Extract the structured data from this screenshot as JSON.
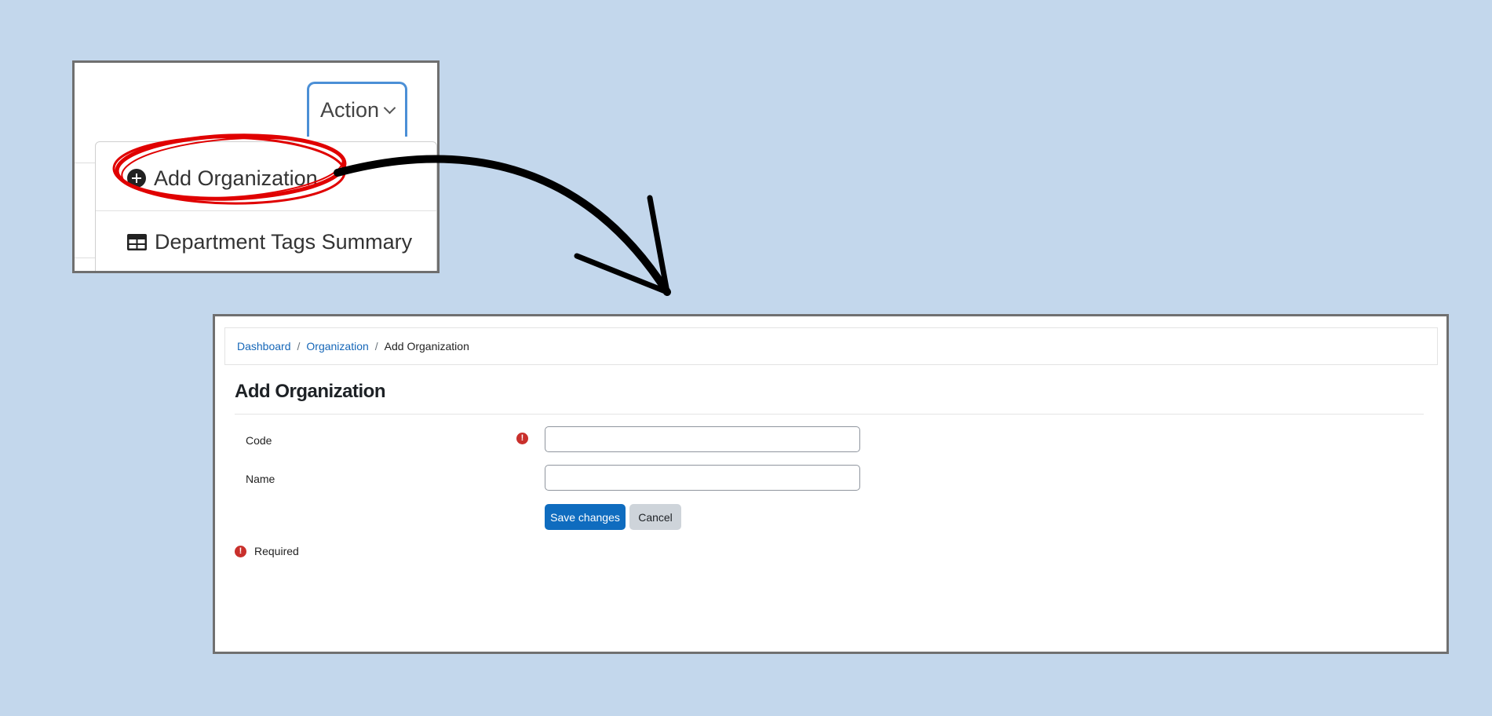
{
  "zoom": {
    "action_button": {
      "label": "Action"
    },
    "menu_items": [
      {
        "label": "Add Organization",
        "icon": "plus-circle-icon"
      },
      {
        "label": "Department Tags Summary",
        "icon": "table-icon"
      }
    ],
    "highlight_color": "#e00000"
  },
  "form": {
    "breadcrumb": {
      "items": [
        "Dashboard",
        "Organization"
      ],
      "current": "Add Organization"
    },
    "title": "Add Organization",
    "fields": [
      {
        "label": "Code",
        "value": "",
        "required": true
      },
      {
        "label": "Name",
        "value": "",
        "required": false
      }
    ],
    "save_label": "Save changes",
    "cancel_label": "Cancel",
    "required_note": "Required",
    "required_icon": "!"
  },
  "colors": {
    "background": "#c3d7ec",
    "primary": "#0f6cbf",
    "link": "#1667b8",
    "required": "#c9302c"
  }
}
